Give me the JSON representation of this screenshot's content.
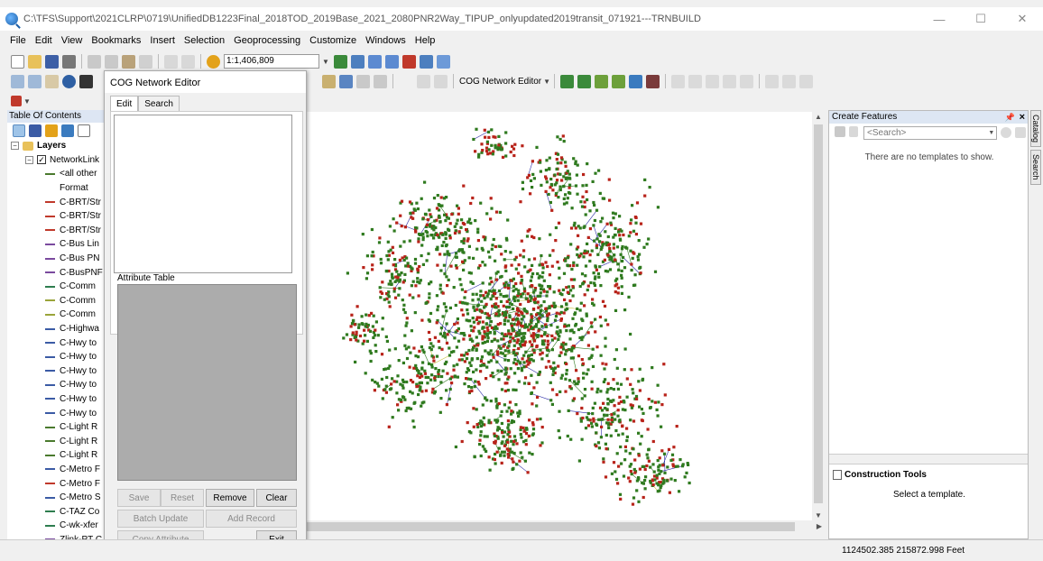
{
  "window": {
    "title": "C:\\TFS\\Support\\2021CLRP\\0719\\UnifiedDB1223Final_2018TOD_2019Base_2021_2080PNR2Way_TIPUP_onlyupdated2019transit_071921---TRNBUILD",
    "minimize": "—",
    "maximize": "☐",
    "close": "✕"
  },
  "menu": [
    "File",
    "Edit",
    "View",
    "Bookmarks",
    "Insert",
    "Selection",
    "Geoprocessing",
    "Customize",
    "Windows",
    "Help"
  ],
  "toolbar": {
    "scale": "1:1,406,809",
    "network_editor_label": "COG Network Editor"
  },
  "toc": {
    "header": "Table Of Contents",
    "root_label": "Layers",
    "layer_label": "NetworkLink",
    "items": [
      {
        "label": "<all other",
        "color": "#4a7a2e"
      },
      {
        "label": "Format",
        "color": ""
      },
      {
        "label": "C-BRT/Str",
        "color": "#c0392b"
      },
      {
        "label": "C-BRT/Str",
        "color": "#c0392b"
      },
      {
        "label": "C-BRT/Str",
        "color": "#c0392b"
      },
      {
        "label": "C-Bus Lin",
        "color": "#7a4a9e"
      },
      {
        "label": "C-Bus PN",
        "color": "#7a4a9e"
      },
      {
        "label": "C-BusPNF",
        "color": "#7a4a9e"
      },
      {
        "label": "C-Comm",
        "color": "#2e7d4f"
      },
      {
        "label": "C-Comm",
        "color": "#9aa43a"
      },
      {
        "label": "C-Comm",
        "color": "#9aa43a"
      },
      {
        "label": "C-Highwa",
        "color": "#3b5ba5"
      },
      {
        "label": "C-Hwy to",
        "color": "#3b5ba5"
      },
      {
        "label": "C-Hwy to",
        "color": "#3b5ba5"
      },
      {
        "label": "C-Hwy to",
        "color": "#3b5ba5"
      },
      {
        "label": "C-Hwy to",
        "color": "#3b5ba5"
      },
      {
        "label": "C-Hwy to",
        "color": "#3b5ba5"
      },
      {
        "label": "C-Hwy to",
        "color": "#3b5ba5"
      },
      {
        "label": "C-Light R",
        "color": "#4a7a2e"
      },
      {
        "label": "C-Light R",
        "color": "#4a7a2e"
      },
      {
        "label": "C-Light R",
        "color": "#4a7a2e"
      },
      {
        "label": "C-Metro F",
        "color": "#3b5ba5"
      },
      {
        "label": "C-Metro F",
        "color": "#c0392b"
      },
      {
        "label": "C-Metro S",
        "color": "#3b5ba5"
      },
      {
        "label": "C-TAZ Co",
        "color": "#2e7d4f"
      },
      {
        "label": "C-wk-xfer",
        "color": "#2e7d4f"
      },
      {
        "label": "Zlink-PT C",
        "color": "#7a4a9e"
      }
    ]
  },
  "dialog": {
    "title": "COG Network Editor",
    "tabs": [
      "Edit",
      "Search"
    ],
    "attribute_table_label": "Attribute Table",
    "buttons": {
      "save": "Save",
      "reset": "Reset",
      "remove": "Remove",
      "clear": "Clear",
      "batch_update": "Batch Update",
      "add_record": "Add Record",
      "copy_attribute": "Copy Attribute",
      "exit": "Exit"
    }
  },
  "create_features": {
    "header": "Create Features",
    "search_placeholder": "<Search>",
    "empty_message": "There are no templates to show.",
    "construction_tools_label": "Construction Tools",
    "construction_message": "Select a template."
  },
  "side_tabs": [
    "Catalog",
    "Search"
  ],
  "status": {
    "coordinates": "1124502.385  215872.998 Feet"
  },
  "colors": {
    "node_green": "#2f7a1f",
    "node_red": "#b8231a",
    "link_blue": "#2a2aa6",
    "link_yellow": "#c7c23a"
  }
}
